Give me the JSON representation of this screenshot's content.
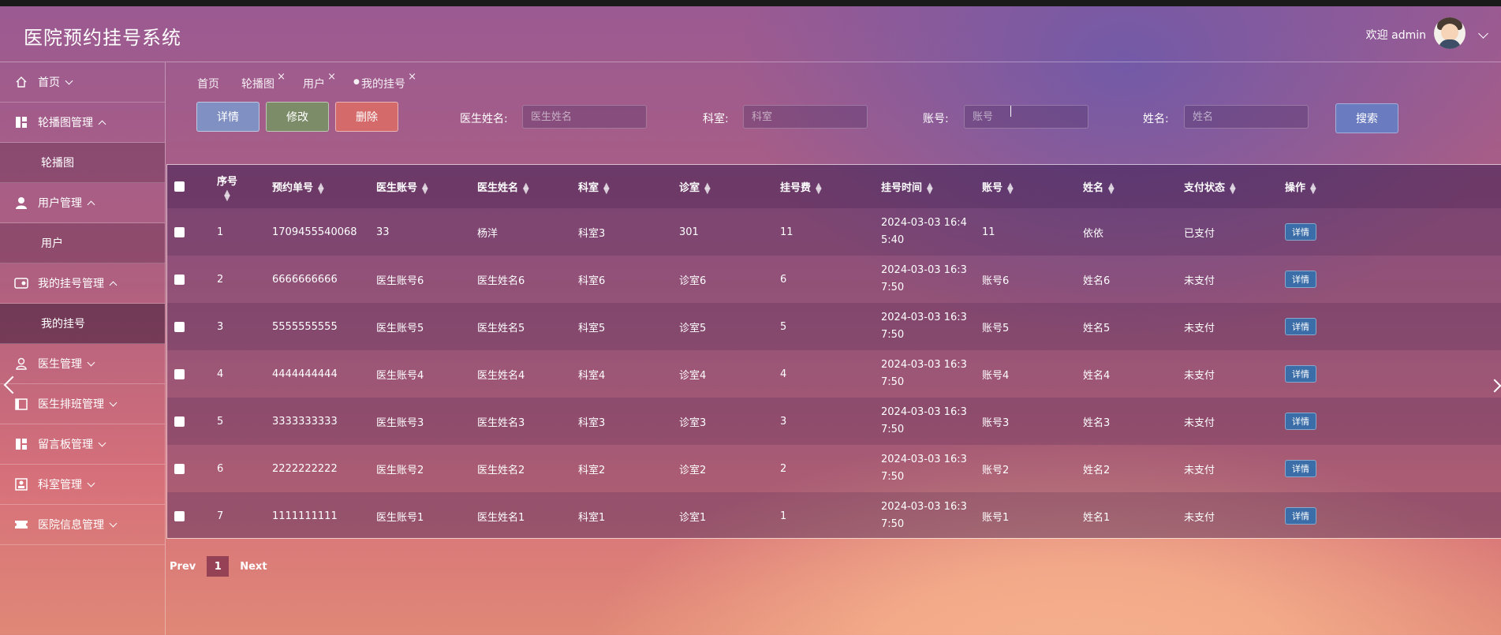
{
  "app": {
    "title": "医院预约挂号系统",
    "welcome": "欢迎 admin"
  },
  "sidebar": {
    "items": [
      {
        "label": "首页",
        "icon": "home-icon",
        "expanded": false
      },
      {
        "label": "轮播图管理",
        "icon": "grid-icon",
        "expanded": true,
        "children": [
          "轮播图"
        ]
      },
      {
        "label": "用户管理",
        "icon": "user-icon",
        "expanded": true,
        "children": [
          "用户"
        ]
      },
      {
        "label": "我的挂号管理",
        "icon": "card-icon",
        "expanded": true,
        "children": [
          "我的挂号"
        ]
      },
      {
        "label": "医生管理",
        "icon": "doctor-icon",
        "expanded": false
      },
      {
        "label": "医生排班管理",
        "icon": "calendar-icon",
        "expanded": false
      },
      {
        "label": "留言板管理",
        "icon": "grid-icon",
        "expanded": false
      },
      {
        "label": "科室管理",
        "icon": "id-card-icon",
        "expanded": false
      },
      {
        "label": "医院信息管理",
        "icon": "ticket-icon",
        "expanded": false
      }
    ]
  },
  "tabs": [
    {
      "label": "首页",
      "closable": false
    },
    {
      "label": "轮播图",
      "closable": true
    },
    {
      "label": "用户",
      "closable": true
    },
    {
      "label": "我的挂号",
      "closable": true,
      "active": true
    }
  ],
  "toolbar": {
    "detail": "详情",
    "edit": "修改",
    "delete": "删除",
    "search": "搜索"
  },
  "filters": {
    "doctor_name": {
      "label": "医生姓名:",
      "placeholder": "医生姓名"
    },
    "department": {
      "label": "科室:",
      "placeholder": "科室"
    },
    "account": {
      "label": "账号:",
      "placeholder": "账号"
    },
    "name": {
      "label": "姓名:",
      "placeholder": "姓名"
    }
  },
  "table": {
    "columns": [
      "序号",
      "预约单号",
      "医生账号",
      "医生姓名",
      "科室",
      "诊室",
      "挂号费",
      "挂号时间",
      "账号",
      "姓名",
      "支付状态",
      "操作"
    ],
    "rows": [
      {
        "no": "1",
        "order": "1709455540068",
        "doc_acc": "33",
        "doc_name": "杨洋",
        "dept": "科室3",
        "room": "301",
        "fee": "11",
        "time1": "2024-03-03 16:4",
        "time2": "5:40",
        "acc": "11",
        "name": "依依",
        "status": "已支付",
        "op": "详情"
      },
      {
        "no": "2",
        "order": "6666666666",
        "doc_acc": "医生账号6",
        "doc_name": "医生姓名6",
        "dept": "科室6",
        "room": "诊室6",
        "fee": "6",
        "time1": "2024-03-03 16:3",
        "time2": "7:50",
        "acc": "账号6",
        "name": "姓名6",
        "status": "未支付",
        "op": "详情"
      },
      {
        "no": "3",
        "order": "5555555555",
        "doc_acc": "医生账号5",
        "doc_name": "医生姓名5",
        "dept": "科室5",
        "room": "诊室5",
        "fee": "5",
        "time1": "2024-03-03 16:3",
        "time2": "7:50",
        "acc": "账号5",
        "name": "姓名5",
        "status": "未支付",
        "op": "详情"
      },
      {
        "no": "4",
        "order": "4444444444",
        "doc_acc": "医生账号4",
        "doc_name": "医生姓名4",
        "dept": "科室4",
        "room": "诊室4",
        "fee": "4",
        "time1": "2024-03-03 16:3",
        "time2": "7:50",
        "acc": "账号4",
        "name": "姓名4",
        "status": "未支付",
        "op": "详情"
      },
      {
        "no": "5",
        "order": "3333333333",
        "doc_acc": "医生账号3",
        "doc_name": "医生姓名3",
        "dept": "科室3",
        "room": "诊室3",
        "fee": "3",
        "time1": "2024-03-03 16:3",
        "time2": "7:50",
        "acc": "账号3",
        "name": "姓名3",
        "status": "未支付",
        "op": "详情"
      },
      {
        "no": "6",
        "order": "2222222222",
        "doc_acc": "医生账号2",
        "doc_name": "医生姓名2",
        "dept": "科室2",
        "room": "诊室2",
        "fee": "2",
        "time1": "2024-03-03 16:3",
        "time2": "7:50",
        "acc": "账号2",
        "name": "姓名2",
        "status": "未支付",
        "op": "详情"
      },
      {
        "no": "7",
        "order": "1111111111",
        "doc_acc": "医生账号1",
        "doc_name": "医生姓名1",
        "dept": "科室1",
        "room": "诊室1",
        "fee": "1",
        "time1": "2024-03-03 16:3",
        "time2": "7:50",
        "acc": "账号1",
        "name": "姓名1",
        "status": "未支付",
        "op": "详情"
      }
    ]
  },
  "pager": {
    "prev": "Prev",
    "page": "1",
    "next": "Next"
  }
}
